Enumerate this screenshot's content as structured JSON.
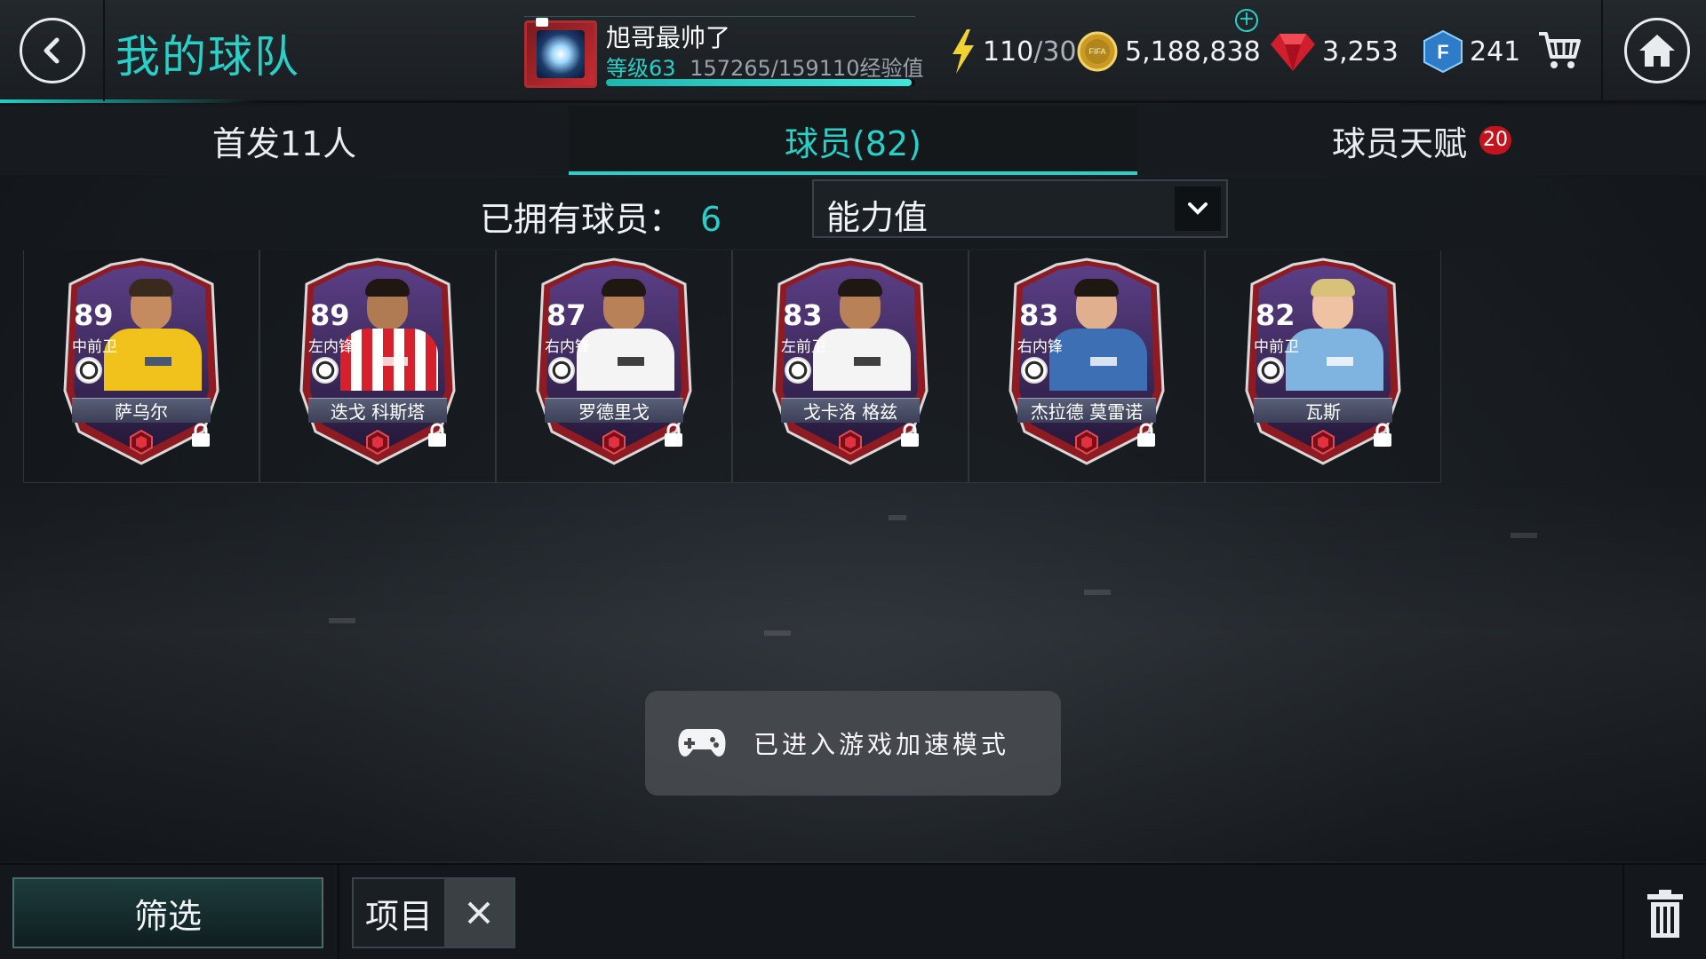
{
  "header": {
    "title": "我的球队",
    "profile": {
      "name": "旭哥最帅了",
      "level_label": "等级63",
      "xp_text": "157265/159110经验值",
      "xp_progress": 0.988
    },
    "energy": {
      "current": "110",
      "max": "/30"
    },
    "coins": "5,188,838",
    "gems": "3,253",
    "fifa_points": "241",
    "plus_symbol": "+"
  },
  "tabs": [
    {
      "label": "首发11人"
    },
    {
      "label": "球员(82)"
    },
    {
      "label": "球员天赋",
      "badge": "20"
    }
  ],
  "filter": {
    "owned_label": "已拥有球员：",
    "owned_count": "6",
    "sort_value": "能力值"
  },
  "players": [
    {
      "rating": "89",
      "position": "中前卫",
      "name": "萨乌尔",
      "kit": "yellow"
    },
    {
      "rating": "89",
      "position": "左内锋",
      "name": "迭戈 科斯塔",
      "kit": "redwhite"
    },
    {
      "rating": "87",
      "position": "右内锋",
      "name": "罗德里戈",
      "kit": "white"
    },
    {
      "rating": "83",
      "position": "左前卫",
      "name": "戈卡洛 格兹",
      "kit": "white"
    },
    {
      "rating": "83",
      "position": "右内锋",
      "name": "杰拉德 莫雷诺",
      "kit": "portrait"
    },
    {
      "rating": "82",
      "position": "中前卫",
      "name": "瓦斯",
      "kit": "portrait-blond"
    }
  ],
  "toast": {
    "message": "已进入游戏加速模式"
  },
  "bottom": {
    "filter_label": "筛选",
    "chip_label": "项目"
  },
  "colors": {
    "accent": "#28d0c8",
    "badge_red": "#c3141d",
    "card_purple": "#3a2a5c"
  }
}
